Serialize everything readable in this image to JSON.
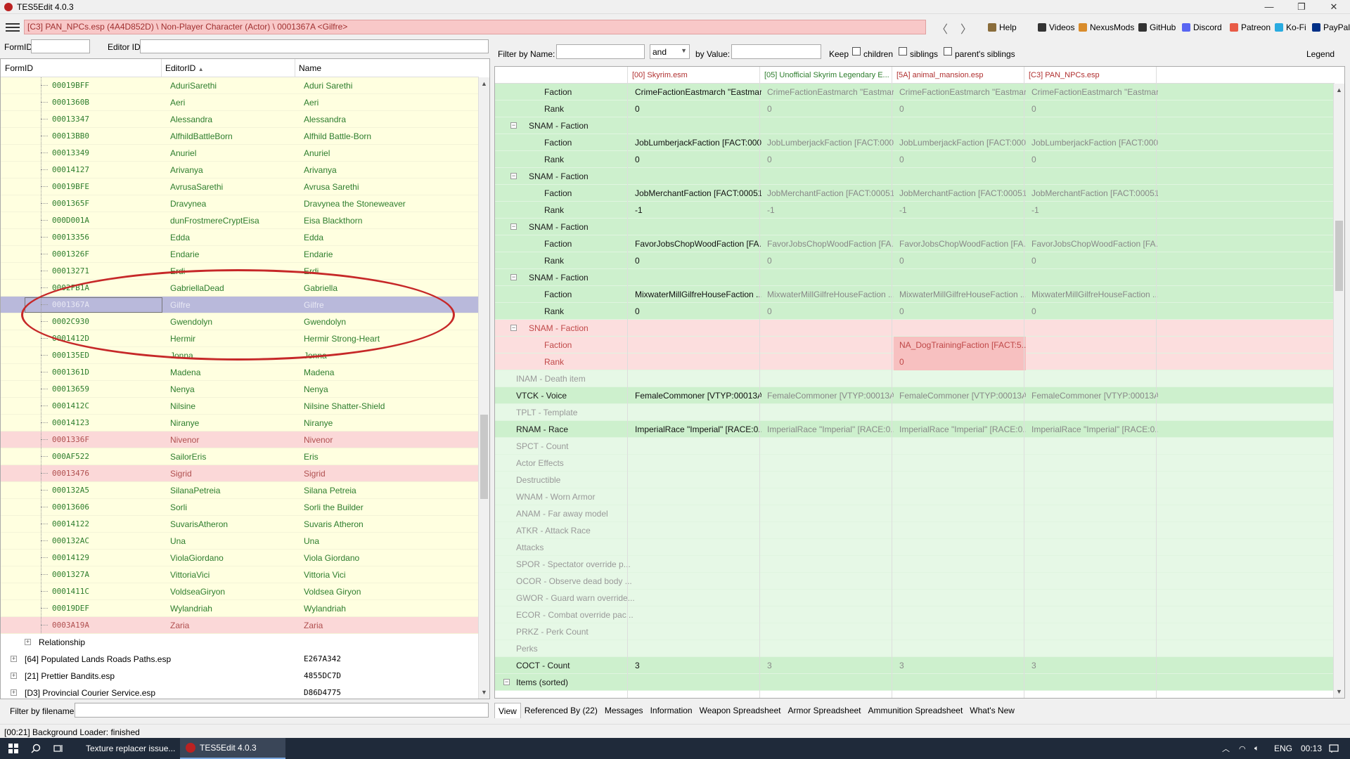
{
  "window": {
    "title": "TES5Edit 4.0.3",
    "controls": [
      "—",
      "❐",
      "✕"
    ]
  },
  "pathbar": {
    "path": "[C3] PAN_NPCs.esp (4A4D852D) \\ Non-Player Character (Actor) \\ 0001367A <Gilfre>",
    "back": "〈",
    "forward": "〉",
    "links": [
      {
        "label": "Help",
        "icon": "book-icon",
        "color": "#8a6d3b"
      },
      {
        "label": "Videos",
        "icon": "video-icon",
        "color": "#333333"
      },
      {
        "label": "NexusMods",
        "icon": "nexus-icon",
        "color": "#d98c2b"
      },
      {
        "label": "GitHub",
        "icon": "github-icon",
        "color": "#333333"
      },
      {
        "label": "Discord",
        "icon": "discord-icon",
        "color": "#5865f2"
      },
      {
        "label": "Patreon",
        "icon": "patreon-icon",
        "color": "#e85b46"
      },
      {
        "label": "Ko-Fi",
        "icon": "kofi-icon",
        "color": "#29abe0"
      },
      {
        "label": "PayPal",
        "icon": "paypal-icon",
        "color": "#003087"
      }
    ]
  },
  "left": {
    "formid_label": "FormID",
    "editorid_label": "Editor ID",
    "columns": {
      "formid": "FormID",
      "editorid": "EditorID",
      "sort_arrow": "▲",
      "name": "Name"
    },
    "rows": [
      {
        "formid": "00019BFF",
        "editorid": "AduriSarethi",
        "name": "Aduri Sarethi",
        "style": "normal"
      },
      {
        "formid": "0001360B",
        "editorid": "Aeri",
        "name": "Aeri",
        "style": "normal"
      },
      {
        "formid": "00013347",
        "editorid": "Alessandra",
        "name": "Alessandra",
        "style": "normal"
      },
      {
        "formid": "00013BB0",
        "editorid": "AlfhildBattleBorn",
        "name": "Alfhild Battle-Born",
        "style": "normal"
      },
      {
        "formid": "00013349",
        "editorid": "Anuriel",
        "name": "Anuriel",
        "style": "normal"
      },
      {
        "formid": "00014127",
        "editorid": "Arivanya",
        "name": "Arivanya",
        "style": "normal"
      },
      {
        "formid": "00019BFE",
        "editorid": "AvrusaSarethi",
        "name": "Avrusa Sarethi",
        "style": "normal"
      },
      {
        "formid": "0001365F",
        "editorid": "Dravynea",
        "name": "Dravynea the Stoneweaver",
        "style": "normal"
      },
      {
        "formid": "000D001A",
        "editorid": "dunFrostmereCryptEisa",
        "name": "Eisa Blackthorn",
        "style": "normal"
      },
      {
        "formid": "00013356",
        "editorid": "Edda",
        "name": "Edda",
        "style": "normal"
      },
      {
        "formid": "0001326F",
        "editorid": "Endarie",
        "name": "Endarie",
        "style": "normal"
      },
      {
        "formid": "00013271",
        "editorid": "Erdi",
        "name": "Erdi",
        "style": "normal"
      },
      {
        "formid": "0002FB1A",
        "editorid": "GabriellaDead",
        "name": "Gabriella",
        "style": "normal"
      },
      {
        "formid": "0001367A",
        "editorid": "Gilfre",
        "name": "Gilfre",
        "style": "selected"
      },
      {
        "formid": "0002C930",
        "editorid": "Gwendolyn",
        "name": "Gwendolyn",
        "style": "normal"
      },
      {
        "formid": "0001412D",
        "editorid": "Hermir",
        "name": "Hermir Strong-Heart",
        "style": "normal"
      },
      {
        "formid": "000135ED",
        "editorid": "Jonna",
        "name": "Jonna",
        "style": "normal"
      },
      {
        "formid": "0001361D",
        "editorid": "Madena",
        "name": "Madena",
        "style": "normal"
      },
      {
        "formid": "00013659",
        "editorid": "Nenya",
        "name": "Nenya",
        "style": "normal"
      },
      {
        "formid": "0001412C",
        "editorid": "Nilsine",
        "name": "Nilsine Shatter-Shield",
        "style": "normal"
      },
      {
        "formid": "00014123",
        "editorid": "Niranye",
        "name": "Niranye",
        "style": "normal"
      },
      {
        "formid": "0001336F",
        "editorid": "Nivenor",
        "name": "Nivenor",
        "style": "pink"
      },
      {
        "formid": "000AF522",
        "editorid": "SailorEris",
        "name": "Eris",
        "style": "normal"
      },
      {
        "formid": "00013476",
        "editorid": "Sigrid",
        "name": "Sigrid",
        "style": "pink"
      },
      {
        "formid": "000132A5",
        "editorid": "SilanaPetreia",
        "name": "Silana Petreia",
        "style": "normal"
      },
      {
        "formid": "00013606",
        "editorid": "Sorli",
        "name": "Sorli the Builder",
        "style": "normal"
      },
      {
        "formid": "00014122",
        "editorid": "SuvarisAtheron",
        "name": "Suvaris Atheron",
        "style": "normal"
      },
      {
        "formid": "000132AC",
        "editorid": "Una",
        "name": "Una",
        "style": "normal"
      },
      {
        "formid": "00014129",
        "editorid": "ViolaGiordano",
        "name": "Viola Giordano",
        "style": "normal"
      },
      {
        "formid": "0001327A",
        "editorid": "VittoriaVici",
        "name": "Vittoria Vici",
        "style": "normal"
      },
      {
        "formid": "0001411C",
        "editorid": "VoldseaGiryon",
        "name": "Voldsea Giryon",
        "style": "normal"
      },
      {
        "formid": "00019DEF",
        "editorid": "Wylandriah",
        "name": "Wylandriah",
        "style": "normal"
      },
      {
        "formid": "0003A19A",
        "editorid": "Zaria",
        "name": "Zaria",
        "style": "pink"
      }
    ],
    "group_row": {
      "label": "Relationship"
    },
    "plugins": [
      {
        "label": "[64] Populated Lands Roads Paths.esp",
        "code": "E267A342"
      },
      {
        "label": "[21] Prettier Bandits.esp",
        "code": "4855DC7D"
      },
      {
        "label": "[D3] Provincial Courier Service.esp",
        "code": "D86D4775"
      }
    ],
    "filter_filename_label": "Filter by filename:"
  },
  "right": {
    "filter_name_label": "Filter by Name:",
    "operator": "and",
    "filter_value_label": "by Value:",
    "keep_label": "Keep",
    "checkboxes": [
      "children",
      "siblings",
      "parent's siblings"
    ],
    "legend_label": "Legend",
    "columns": [
      "[00] Skyrim.esm",
      "[05] Unofficial Skyrim Legendary E...",
      "[5A] animal_mansion.esp",
      "[C3] PAN_NPCs.esp"
    ],
    "rows": [
      {
        "label": "Faction",
        "indent": 2,
        "style": "green",
        "values": [
          "CrimeFactionEastmarch \"Eastmar...",
          "CrimeFactionEastmarch \"Eastmar...",
          "CrimeFactionEastmarch \"Eastmar...",
          "CrimeFactionEastmarch \"Eastmar..."
        ]
      },
      {
        "label": "Rank",
        "indent": 2,
        "style": "green",
        "values": [
          "0",
          "0",
          "0",
          "0"
        ]
      },
      {
        "label": "SNAM - Faction",
        "indent": 1,
        "style": "green",
        "expander": "−",
        "values": [
          "",
          "",
          "",
          ""
        ]
      },
      {
        "label": "Faction",
        "indent": 2,
        "style": "green",
        "values": [
          "JobLumberjackFaction [FACT:000...",
          "JobLumberjackFaction [FACT:000...",
          "JobLumberjackFaction [FACT:000...",
          "JobLumberjackFaction [FACT:000..."
        ]
      },
      {
        "label": "Rank",
        "indent": 2,
        "style": "green",
        "values": [
          "0",
          "0",
          "0",
          "0"
        ]
      },
      {
        "label": "SNAM - Faction",
        "indent": 1,
        "style": "green",
        "expander": "−",
        "values": [
          "",
          "",
          "",
          ""
        ]
      },
      {
        "label": "Faction",
        "indent": 2,
        "style": "green",
        "values": [
          "JobMerchantFaction [FACT:00051...",
          "JobMerchantFaction [FACT:00051...",
          "JobMerchantFaction [FACT:00051...",
          "JobMerchantFaction [FACT:00051..."
        ]
      },
      {
        "label": "Rank",
        "indent": 2,
        "style": "green",
        "values": [
          "-1",
          "-1",
          "-1",
          "-1"
        ]
      },
      {
        "label": "SNAM - Faction",
        "indent": 1,
        "style": "green",
        "expander": "−",
        "values": [
          "",
          "",
          "",
          ""
        ]
      },
      {
        "label": "Faction",
        "indent": 2,
        "style": "green",
        "values": [
          "FavorJobsChopWoodFaction [FA...",
          "FavorJobsChopWoodFaction [FA...",
          "FavorJobsChopWoodFaction [FA...",
          "FavorJobsChopWoodFaction [FA..."
        ]
      },
      {
        "label": "Rank",
        "indent": 2,
        "style": "green",
        "values": [
          "0",
          "0",
          "0",
          "0"
        ]
      },
      {
        "label": "SNAM - Faction",
        "indent": 1,
        "style": "green",
        "expander": "−",
        "values": [
          "",
          "",
          "",
          ""
        ]
      },
      {
        "label": "Faction",
        "indent": 2,
        "style": "green",
        "values": [
          "MixwaterMillGilfreHouseFaction ...",
          "MixwaterMillGilfreHouseFaction ...",
          "MixwaterMillGilfreHouseFaction ...",
          "MixwaterMillGilfreHouseFaction ..."
        ]
      },
      {
        "label": "Rank",
        "indent": 2,
        "style": "green",
        "values": [
          "0",
          "0",
          "0",
          "0"
        ]
      },
      {
        "label": "SNAM - Faction",
        "indent": 1,
        "style": "red",
        "expander": "−",
        "values": [
          "",
          "",
          "",
          ""
        ]
      },
      {
        "label": "Faction",
        "indent": 2,
        "style": "red",
        "values": [
          "",
          "",
          "NA_DogTrainingFaction [FACT:5...",
          ""
        ]
      },
      {
        "label": "Rank",
        "indent": 2,
        "style": "red",
        "values": [
          "",
          "",
          "0",
          ""
        ]
      },
      {
        "label": "INAM - Death item",
        "indent": 0,
        "style": "light",
        "values": [
          "",
          "",
          "",
          ""
        ]
      },
      {
        "label": "VTCK - Voice",
        "indent": 0,
        "style": "green",
        "values": [
          "FemaleCommoner [VTYP:00013A...",
          "FemaleCommoner [VTYP:00013A...",
          "FemaleCommoner [VTYP:00013A...",
          "FemaleCommoner [VTYP:00013A..."
        ]
      },
      {
        "label": "TPLT - Template",
        "indent": 0,
        "style": "light",
        "values": [
          "",
          "",
          "",
          ""
        ]
      },
      {
        "label": "RNAM - Race",
        "indent": 0,
        "style": "green",
        "values": [
          "ImperialRace \"Imperial\" [RACE:0...",
          "ImperialRace \"Imperial\" [RACE:0...",
          "ImperialRace \"Imperial\" [RACE:0...",
          "ImperialRace \"Imperial\" [RACE:0..."
        ]
      },
      {
        "label": "SPCT - Count",
        "indent": 0,
        "style": "light",
        "values": [
          "",
          "",
          "",
          ""
        ]
      },
      {
        "label": "Actor Effects",
        "indent": 0,
        "style": "light",
        "values": [
          "",
          "",
          "",
          ""
        ]
      },
      {
        "label": "Destructible",
        "indent": 0,
        "style": "light",
        "values": [
          "",
          "",
          "",
          ""
        ]
      },
      {
        "label": "WNAM - Worn Armor",
        "indent": 0,
        "style": "light",
        "values": [
          "",
          "",
          "",
          ""
        ]
      },
      {
        "label": "ANAM - Far away model",
        "indent": 0,
        "style": "light",
        "values": [
          "",
          "",
          "",
          ""
        ]
      },
      {
        "label": "ATKR - Attack Race",
        "indent": 0,
        "style": "light",
        "values": [
          "",
          "",
          "",
          ""
        ]
      },
      {
        "label": "Attacks",
        "indent": 0,
        "style": "light",
        "values": [
          "",
          "",
          "",
          ""
        ]
      },
      {
        "label": "SPOR - Spectator override p...",
        "indent": 0,
        "style": "light",
        "values": [
          "",
          "",
          "",
          ""
        ]
      },
      {
        "label": "OCOR - Observe dead body ...",
        "indent": 0,
        "style": "light",
        "values": [
          "",
          "",
          "",
          ""
        ]
      },
      {
        "label": "GWOR - Guard warn override...",
        "indent": 0,
        "style": "light",
        "values": [
          "",
          "",
          "",
          ""
        ]
      },
      {
        "label": "ECOR - Combat override pac...",
        "indent": 0,
        "style": "light",
        "values": [
          "",
          "",
          "",
          ""
        ]
      },
      {
        "label": "PRKZ - Perk Count",
        "indent": 0,
        "style": "light",
        "values": [
          "",
          "",
          "",
          ""
        ]
      },
      {
        "label": "Perks",
        "indent": 0,
        "style": "light",
        "values": [
          "",
          "",
          "",
          ""
        ]
      },
      {
        "label": "COCT - Count",
        "indent": 0,
        "style": "green",
        "values": [
          "3",
          "3",
          "3",
          "3"
        ]
      },
      {
        "label": "Items (sorted)",
        "indent": 0,
        "style": "green",
        "expander": "−",
        "values": [
          "",
          "",
          "",
          ""
        ]
      }
    ],
    "tabs": [
      "View",
      "Referenced By (22)",
      "Messages",
      "Information",
      "Weapon Spreadsheet",
      "Armor Spreadsheet",
      "Ammunition Spreadsheet",
      "What's New"
    ]
  },
  "status": "[00:21] Background Loader: finished",
  "taskbar": {
    "tasks": [
      {
        "label": "Texture replacer issue...",
        "icon": "firefox-icon",
        "active": false
      },
      {
        "label": "TES5Edit 4.0.3",
        "icon": "tes5edit-icon",
        "active": true
      }
    ],
    "lang": "ENG",
    "time": "00:13"
  }
}
